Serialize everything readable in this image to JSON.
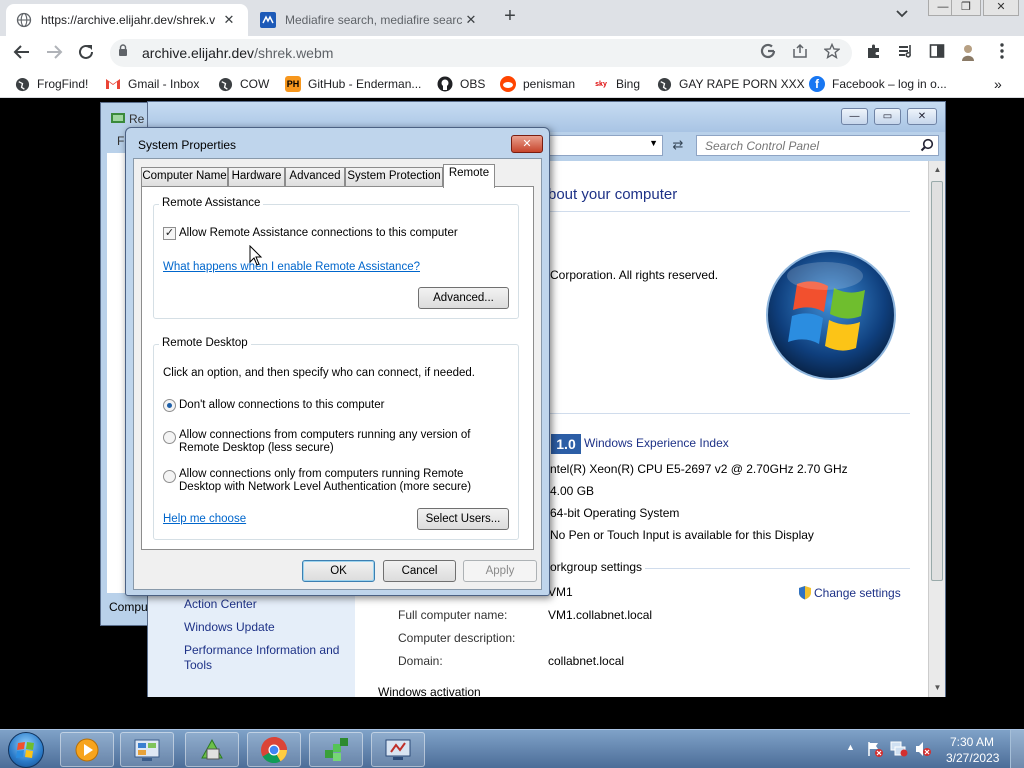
{
  "browser": {
    "tabs": [
      {
        "title": "https://archive.elijahr.dev/shrek.v",
        "close": "✕"
      },
      {
        "title": "Mediafire search, mediafire searc",
        "close": "✕"
      }
    ],
    "new_tab": "+",
    "window_controls": {
      "minimize": "—",
      "restore": "❐",
      "close": "✕"
    },
    "address": {
      "host": "archive.elijahr.dev",
      "path": "/shrek.webm"
    },
    "bookmarks": [
      "FrogFind!",
      "Gmail - Inbox",
      "COW",
      "GitHub - Enderman...",
      "OBS",
      "penisman",
      "Bing",
      "GAY RAPE PORN XXX",
      "Facebook – log in o..."
    ],
    "bookmark_overflow": "»"
  },
  "control_panel": {
    "search_placeholder": "Search Control Panel",
    "heading": "bout your computer",
    "copyright": "Corporation.  All rights reserved.",
    "wei_score": "1.0",
    "wei_link": "Windows Experience Index",
    "processor": "ntel(R) Xeon(R) CPU E5-2697 v2 @ 2.70GHz   2.70 GHz",
    "memory": "4.00 GB",
    "system_type": "64-bit Operating System",
    "pen_touch": "No Pen or Touch Input is available for this Display",
    "workgroup_heading": "orkgroup settings",
    "computer_name_value": "VM1",
    "change_settings": "Change settings",
    "full_name_label": "Full computer name:",
    "full_name_value": "VM1.collabnet.local",
    "description_label": "Computer description:",
    "domain_label": "Domain:",
    "domain_value": "collabnet.local",
    "cut_off_text": "Windows activation",
    "nav_links": [
      "Action Center",
      "Windows Update",
      "Performance Information and",
      "Tools"
    ]
  },
  "mid_window": {
    "title": "Re",
    "menu": "Fi",
    "status": "Compu"
  },
  "dialog": {
    "title": "System Properties",
    "tabs": [
      "Computer Name",
      "Hardware",
      "Advanced",
      "System Protection",
      "Remote"
    ],
    "remote_assistance": {
      "group_title": "Remote Assistance",
      "checkbox_label": "Allow Remote Assistance connections to this computer",
      "checkbox_mark": "✓",
      "link": "What happens when I enable Remote Assistance?",
      "advanced_button": "Advanced..."
    },
    "remote_desktop": {
      "group_title": "Remote Desktop",
      "intro": "Click an option, and then specify who can connect, if needed.",
      "option1": "Don't allow connections to this computer",
      "option2_line1": "Allow connections from computers running any version of",
      "option2_line2": "Remote Desktop (less secure)",
      "option3_line1": "Allow connections only from computers running Remote",
      "option3_line2": "Desktop with Network Level Authentication (more secure)",
      "help_link": "Help me choose",
      "select_users_button": "Select Users..."
    },
    "ok": "OK",
    "cancel": "Cancel",
    "apply": "Apply"
  },
  "taskbar": {
    "time": "7:30 AM",
    "date": "3/27/2023"
  }
}
